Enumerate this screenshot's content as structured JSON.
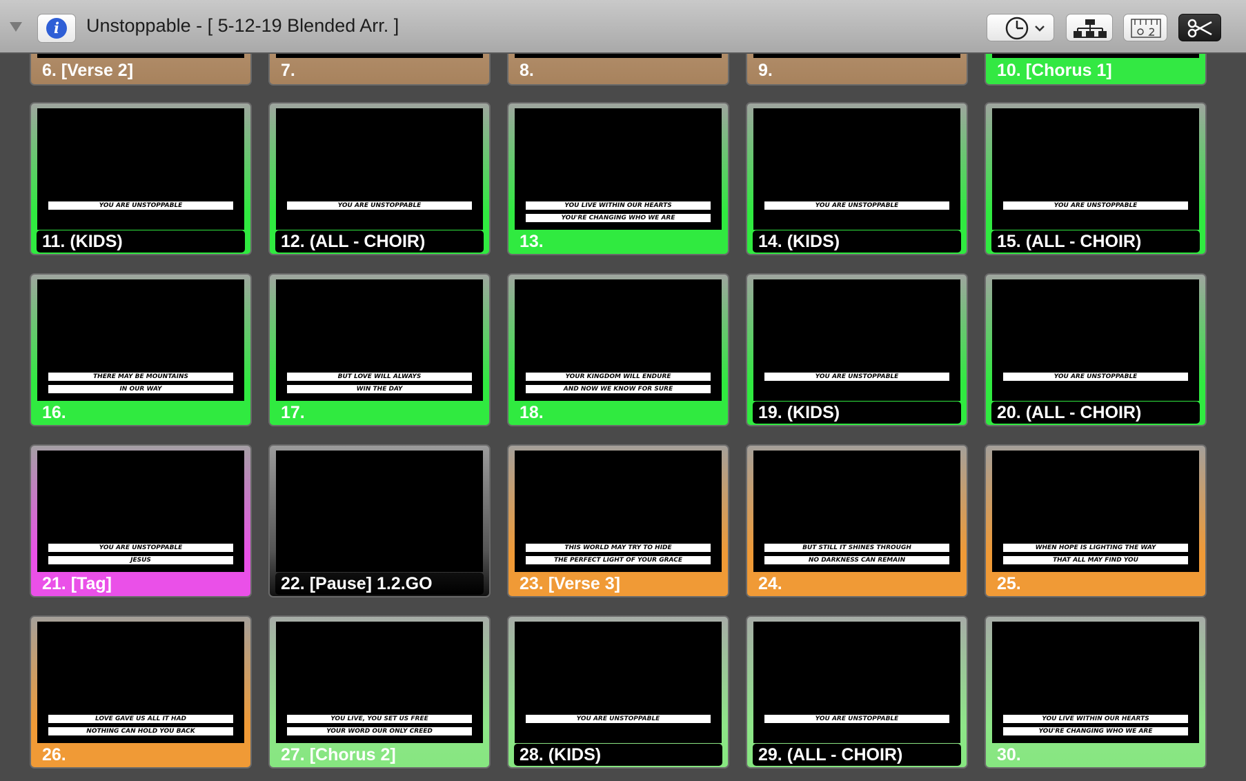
{
  "window": {
    "title": "Unstoppable - [ 5-12-19 Blended Arr. ]"
  },
  "toolbar": {
    "icons": [
      "info-icon",
      "clock-icon",
      "hierarchy-icon",
      "ruler-icon",
      "scissors-icon"
    ]
  },
  "colors": {
    "green": "#30ea40",
    "light_green": "#86e680",
    "orange": "#f09a36",
    "magenta": "#ea50e8",
    "tan": "#a7825d"
  },
  "top_row": [
    {
      "label": "6. [Verse 2]",
      "color": "tan"
    },
    {
      "label": "7.",
      "color": "tan"
    },
    {
      "label": "8.",
      "color": "tan"
    },
    {
      "label": "9.",
      "color": "tan"
    },
    {
      "label": "10. [Chorus 1]",
      "color": "bright-green"
    }
  ],
  "slides": [
    {
      "label": "11. (KIDS)",
      "color": "green",
      "boxed": true,
      "lines": [
        "YOU ARE UNSTOPPABLE"
      ]
    },
    {
      "label": "12. (ALL - CHOIR)",
      "color": "green",
      "boxed": true,
      "lines": [
        "YOU ARE UNSTOPPABLE"
      ]
    },
    {
      "label": "13.",
      "color": "green",
      "boxed": false,
      "lines": [
        "YOU LIVE WITHIN OUR HEARTS",
        "YOU'RE CHANGING WHO WE ARE"
      ]
    },
    {
      "label": "14. (KIDS)",
      "color": "green",
      "boxed": true,
      "lines": [
        "YOU ARE UNSTOPPABLE"
      ]
    },
    {
      "label": "15. (ALL - CHOIR)",
      "color": "green",
      "boxed": true,
      "lines": [
        "YOU ARE UNSTOPPABLE"
      ]
    },
    {
      "label": "16.",
      "color": "green",
      "boxed": false,
      "lines": [
        "THERE MAY BE MOUNTAINS",
        "IN OUR WAY"
      ]
    },
    {
      "label": "17.",
      "color": "green",
      "boxed": false,
      "lines": [
        "BUT LOVE WILL ALWAYS",
        "WIN THE DAY"
      ]
    },
    {
      "label": "18.",
      "color": "green",
      "boxed": false,
      "lines": [
        "YOUR KINGDOM WILL ENDURE",
        "AND NOW WE KNOW FOR SURE"
      ]
    },
    {
      "label": "19. (KIDS)",
      "color": "green",
      "boxed": true,
      "lines": [
        "YOU ARE UNSTOPPABLE"
      ]
    },
    {
      "label": "20. (ALL - CHOIR)",
      "color": "green",
      "boxed": true,
      "lines": [
        "YOU ARE UNSTOPPABLE"
      ]
    },
    {
      "label": "21. [Tag]",
      "color": "magenta",
      "boxed": false,
      "lines": [
        "YOU ARE UNSTOPPABLE",
        "JESUS"
      ]
    },
    {
      "label": "22. [Pause] 1.2.GO",
      "color": "gray",
      "boxed": false,
      "lines": []
    },
    {
      "label": "23. [Verse 3]",
      "color": "orange",
      "boxed": false,
      "lines": [
        "THIS WORLD MAY TRY TO HIDE",
        "THE PERFECT LIGHT OF YOUR GRACE"
      ]
    },
    {
      "label": "24.",
      "color": "orange",
      "boxed": false,
      "lines": [
        "BUT STILL IT SHINES THROUGH",
        "NO DARKNESS CAN REMAIN"
      ]
    },
    {
      "label": "25.",
      "color": "orange",
      "boxed": false,
      "lines": [
        "WHEN HOPE IS LIGHTING THE WAY",
        "THAT ALL MAY FIND YOU"
      ]
    },
    {
      "label": "26.",
      "color": "orange",
      "boxed": false,
      "lines": [
        "LOVE GAVE US ALL IT HAD",
        "NOTHING CAN HOLD YOU BACK"
      ]
    },
    {
      "label": "27. [Chorus 2]",
      "color": "lgreen",
      "boxed": false,
      "lines": [
        "YOU LIVE, YOU SET US FREE",
        "YOUR WORD OUR ONLY CREED"
      ]
    },
    {
      "label": "28. (KIDS)",
      "color": "lgreen",
      "boxed": true,
      "lines": [
        "YOU ARE UNSTOPPABLE"
      ]
    },
    {
      "label": "29. (ALL - CHOIR)",
      "color": "lgreen",
      "boxed": true,
      "lines": [
        "YOU ARE UNSTOPPABLE"
      ]
    },
    {
      "label": "30.",
      "color": "lgreen",
      "boxed": false,
      "lines": [
        "YOU LIVE WITHIN OUR HEARTS",
        "YOU'RE CHANGING WHO WE ARE"
      ]
    }
  ]
}
